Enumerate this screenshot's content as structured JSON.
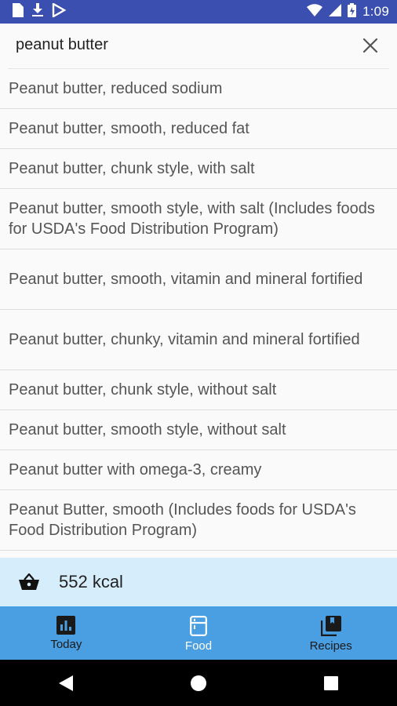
{
  "status_bar": {
    "time": "1:09",
    "icons": [
      "document-icon",
      "download-icon",
      "play-store-icon",
      "wifi-icon",
      "signal-icon",
      "battery-icon"
    ]
  },
  "search": {
    "query": "peanut butter",
    "clear_icon": "close-icon"
  },
  "results": [
    "Peanut butter, reduced sodium",
    "Peanut butter, smooth, reduced fat",
    "Peanut butter, chunk style, with salt",
    "Peanut butter, smooth style, with salt (Includes foods for USDA's Food Distribution Program)",
    "Peanut butter, smooth, vitamin and mineral fortified",
    "Peanut butter, chunky, vitamin and mineral fortified",
    "Peanut butter, chunk style, without salt",
    "Peanut butter, smooth style, without salt",
    "Peanut butter with omega-3, creamy",
    "Peanut Butter, smooth (Includes foods for USDA's Food Distribution Program)"
  ],
  "summary": {
    "icon": "basket-icon",
    "kcal": "552 kcal"
  },
  "bottom_nav": {
    "tabs": [
      {
        "label": "Today",
        "icon": "bar-chart-icon",
        "active": false
      },
      {
        "label": "Food",
        "icon": "fridge-icon",
        "active": true
      },
      {
        "label": "Recipes",
        "icon": "book-stack-icon",
        "active": false
      }
    ]
  },
  "colors": {
    "status_bar": "#3b4fb0",
    "summary_bg": "#d6edfc",
    "nav_bg": "#4a9ee2",
    "active_tab": "#ffffff"
  }
}
